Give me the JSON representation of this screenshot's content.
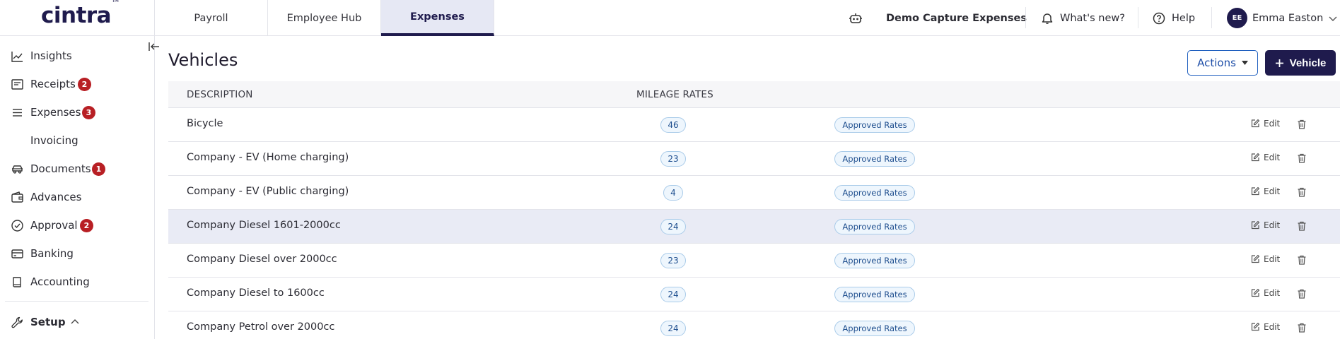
{
  "brand": {
    "name": "cintra",
    "tm": "TM"
  },
  "tabs": [
    {
      "label": "Payroll",
      "active": false
    },
    {
      "label": "Employee Hub",
      "active": false
    },
    {
      "label": "Expenses",
      "active": true
    }
  ],
  "topbar": {
    "company": "Demo Capture Expenses",
    "whats_new": "What's new?",
    "help": "Help",
    "user_initials": "EE",
    "user_name": "Emma Easton"
  },
  "sidebar": {
    "items": [
      {
        "label": "Insights",
        "icon": "chart-line-icon"
      },
      {
        "label": "Receipts",
        "icon": "receipt-icon",
        "badge": "2"
      },
      {
        "label": "Expenses",
        "icon": "list-icon",
        "badge": "3"
      },
      {
        "label": "Invoicing",
        "icon": ""
      },
      {
        "label": "Documents",
        "icon": "car-icon",
        "badge": "1"
      },
      {
        "label": "Advances",
        "icon": "wallet-icon"
      },
      {
        "label": "Approval",
        "icon": "check-circle-icon",
        "badge": "2"
      },
      {
        "label": "Banking",
        "icon": "card-icon"
      },
      {
        "label": "Accounting",
        "icon": "book-icon"
      }
    ],
    "setup_label": "Setup"
  },
  "main": {
    "title": "Vehicles",
    "actions_label": "Actions",
    "add_label": "Vehicle",
    "columns": {
      "description": "DESCRIPTION",
      "mileage_rates": "MILEAGE RATES"
    },
    "rows": [
      {
        "description": "Bicycle",
        "rates": "46",
        "status": "Approved Rates",
        "edit": "Edit"
      },
      {
        "description": "Company - EV (Home charging)",
        "rates": "23",
        "status": "Approved Rates",
        "edit": "Edit"
      },
      {
        "description": "Company - EV (Public charging)",
        "rates": "4",
        "status": "Approved Rates",
        "edit": "Edit"
      },
      {
        "description": "Company Diesel 1601-2000cc",
        "rates": "24",
        "status": "Approved Rates",
        "edit": "Edit"
      },
      {
        "description": "Company Diesel over 2000cc",
        "rates": "23",
        "status": "Approved Rates",
        "edit": "Edit"
      },
      {
        "description": "Company Diesel to 1600cc",
        "rates": "24",
        "status": "Approved Rates",
        "edit": "Edit"
      },
      {
        "description": "Company Petrol over 2000cc",
        "rates": "24",
        "status": "Approved Rates",
        "edit": "Edit"
      }
    ],
    "highlighted_row": 3
  },
  "colors": {
    "brand": "#1f1b4d",
    "badge": "#b81f24",
    "pill_border": "#a9cbe9",
    "pill_text": "#1f4f8f"
  }
}
